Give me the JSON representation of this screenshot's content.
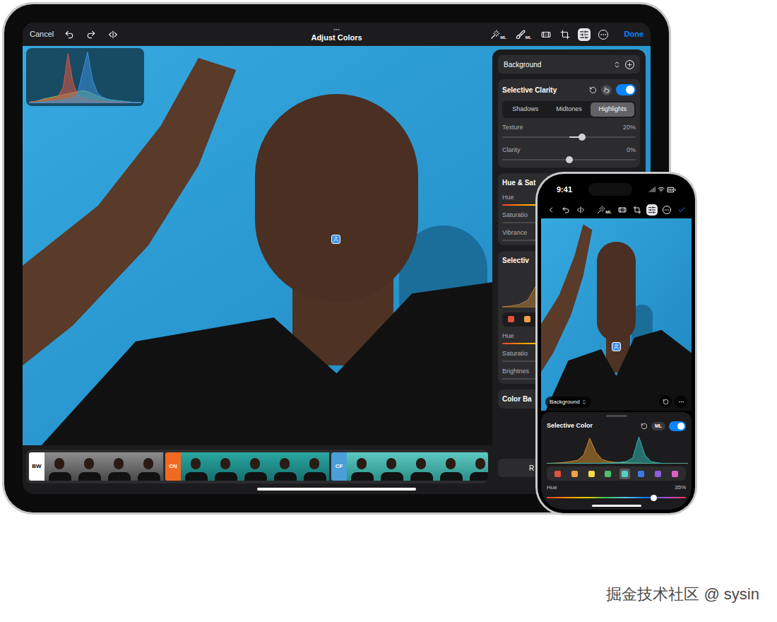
{
  "ipad": {
    "toolbar": {
      "cancel": "Cancel",
      "grabber": "•••",
      "title": "Adjust Colors",
      "done": "Done",
      "left_tools": [
        {
          "kind": "undo"
        },
        {
          "kind": "redo"
        },
        {
          "kind": "compare"
        }
      ],
      "right_tools": [
        {
          "kind": "wand",
          "badge": "ML",
          "selected": false
        },
        {
          "kind": "brush",
          "badge": "ML",
          "selected": false
        },
        {
          "kind": "repair",
          "badge": "",
          "selected": false
        },
        {
          "kind": "crop",
          "badge": "",
          "selected": false
        },
        {
          "kind": "adjust",
          "badge": "",
          "selected": true
        },
        {
          "kind": "more",
          "badge": "",
          "selected": false
        }
      ]
    },
    "histogram": {
      "series": [
        {
          "color": "#7fbf5a",
          "values": [
            2,
            3,
            5,
            8,
            10,
            12,
            14,
            16,
            18,
            20,
            22,
            24,
            22,
            18,
            14,
            10,
            8,
            6,
            5,
            4,
            3,
            2,
            2,
            1
          ]
        },
        {
          "color": "#e0553f",
          "values": [
            2,
            3,
            4,
            6,
            8,
            10,
            14,
            30,
            95,
            40,
            15,
            10,
            8,
            6,
            5,
            4,
            3,
            3,
            2,
            2,
            2,
            1,
            1,
            1
          ]
        },
        {
          "color": "#3b8fd9",
          "values": [
            1,
            1,
            2,
            2,
            3,
            4,
            5,
            6,
            8,
            10,
            20,
            60,
            98,
            45,
            20,
            12,
            8,
            6,
            5,
            4,
            3,
            2,
            2,
            1
          ]
        }
      ]
    },
    "panel": {
      "layer": {
        "label": "Background"
      },
      "clarity": {
        "title": "Selective Clarity",
        "on": true,
        "segments": [
          {
            "label": "Shadows",
            "selected": false
          },
          {
            "label": "Midtones",
            "selected": false
          },
          {
            "label": "Highlights",
            "selected": true
          }
        ],
        "sliders": [
          {
            "label": "Texture",
            "reading": "20%",
            "level": 0.6
          },
          {
            "label": "Clarity",
            "reading": "0%",
            "level": 0.5
          }
        ]
      },
      "hue_saturation": {
        "title": "Hue & Sat",
        "rows": [
          {
            "label": "Hue",
            "kind": "hue"
          },
          {
            "label": "Saturatio",
            "kind": "plain"
          },
          {
            "label": "Vibrance",
            "kind": "plain"
          }
        ]
      },
      "selective_color": {
        "title": "Selectiv",
        "histogram": {
          "series": [
            {
              "color": "#b07a3a",
              "values": [
                2,
                4,
                8,
                20,
                60,
                92,
                40,
                20,
                10,
                6,
                4,
                3,
                2,
                2,
                1,
                1
              ]
            }
          ]
        },
        "swatches": [
          {
            "color": "#e0533d",
            "selected": false
          },
          {
            "color": "#f0a046",
            "selected": false
          }
        ],
        "rows": [
          {
            "label": "Hue",
            "kind": "hue"
          },
          {
            "label": "Saturatio",
            "kind": "plain"
          },
          {
            "label": "Brightnes",
            "kind": "plain"
          }
        ]
      },
      "color_balance": {
        "title": "Color Ba"
      },
      "button": {
        "label": "R"
      }
    },
    "filters": [
      {
        "label": "BW",
        "kind": "mono",
        "color": "#ffffff",
        "thumbnails": [
          {
            "selected": false
          },
          {
            "selected": false
          },
          {
            "selected": false
          },
          {
            "selected": false
          }
        ]
      },
      {
        "label": "CN",
        "kind": "teal",
        "color": "#f26a21",
        "thumbnails": [
          {
            "selected": false
          },
          {
            "selected": false
          },
          {
            "selected": false
          },
          {
            "selected": false
          },
          {
            "selected": false
          }
        ]
      },
      {
        "label": "CF",
        "kind": "mint",
        "color": "#4a9fd8",
        "thumbnails": [
          {
            "selected": false
          },
          {
            "selected": false
          },
          {
            "selected": false
          },
          {
            "selected": false
          },
          {
            "selected": false
          }
        ]
      }
    ]
  },
  "iphone": {
    "status": {
      "time": "9:41"
    },
    "toolbar": {
      "left_tools": [
        {
          "kind": "back"
        },
        {
          "kind": "undo"
        },
        {
          "kind": "compare"
        }
      ],
      "right_tools": [
        {
          "kind": "wand",
          "badge": "ML",
          "selected": false
        },
        {
          "kind": "repair",
          "badge": "",
          "selected": false
        },
        {
          "kind": "crop",
          "badge": "",
          "selected": false
        },
        {
          "kind": "adjust",
          "badge": "",
          "selected": true
        },
        {
          "kind": "more",
          "badge": "",
          "selected": false
        },
        {
          "kind": "done",
          "badge": "",
          "selected": false
        }
      ]
    },
    "layer": {
      "label": "Background"
    },
    "sheet": {
      "title": "Selective Color",
      "badge": "ML",
      "on": true,
      "histogram": {
        "series": [
          {
            "color": "#c98a2e",
            "values": [
              1,
              2,
              3,
              5,
              8,
              12,
              30,
              90,
              40,
              15,
              8,
              5,
              4,
              3,
              2,
              2,
              1,
              1,
              1,
              1,
              1,
              1,
              1,
              1
            ]
          },
          {
            "color": "#2fb5b0",
            "values": [
              0,
              0,
              0,
              0,
              0,
              1,
              1,
              1,
              1,
              2,
              2,
              3,
              5,
              8,
              20,
              95,
              30,
              8,
              3,
              1,
              0,
              0,
              0,
              0
            ]
          }
        ]
      },
      "swatches": [
        {
          "color": "#e0533d",
          "selected": false
        },
        {
          "color": "#f0a046",
          "selected": false
        },
        {
          "color": "#f2dc4a",
          "selected": false
        },
        {
          "color": "#4cc46a",
          "selected": false
        },
        {
          "color": "#4fd1c5",
          "selected": true
        },
        {
          "color": "#3b7be0",
          "selected": false
        },
        {
          "color": "#8e5ee0",
          "selected": false
        },
        {
          "color": "#e05ec8",
          "selected": false
        }
      ],
      "slider": {
        "label": "Hue",
        "reading": "35%",
        "level": 0.77
      }
    }
  },
  "watermark": "掘金技术社区 @ sysin"
}
